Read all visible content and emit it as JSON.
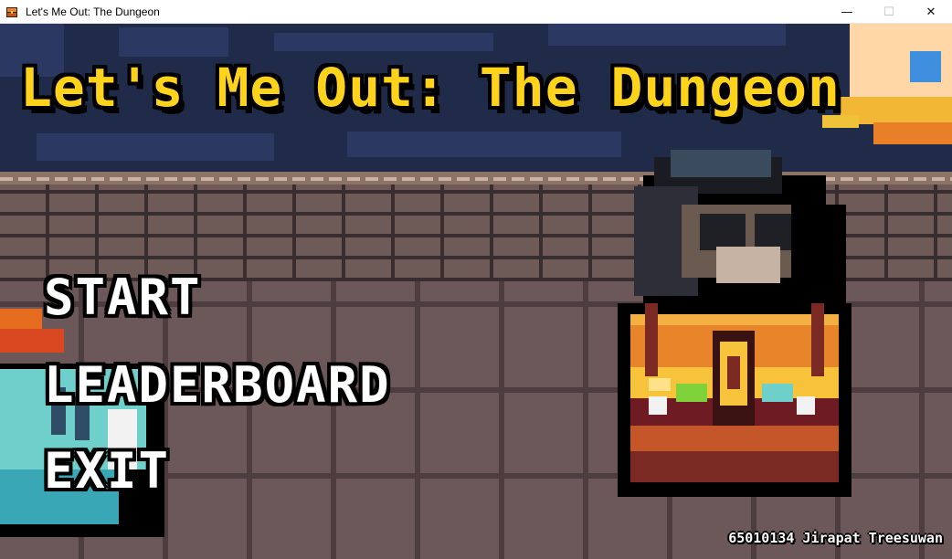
{
  "window": {
    "title": "Let's Me Out: The Dungeon",
    "icon": "treasure-chest-icon",
    "controls": {
      "minimize": "—",
      "maximize": "☐",
      "close": "✕"
    }
  },
  "game": {
    "title": "Let's Me Out: The Dungeon",
    "menu": {
      "start_label": "START",
      "leaderboard_label": "LEADERBOARD",
      "exit_label": "EXIT"
    },
    "credit": "65010134 Jirapat Treesuwan"
  },
  "colors": {
    "title_yellow": "#ffd21c",
    "menu_white": "#ffffff",
    "outline": "#000000",
    "wall_navy": "#202a49",
    "floor_brown": "#6c5858",
    "chest_orange": "#e8852b"
  }
}
